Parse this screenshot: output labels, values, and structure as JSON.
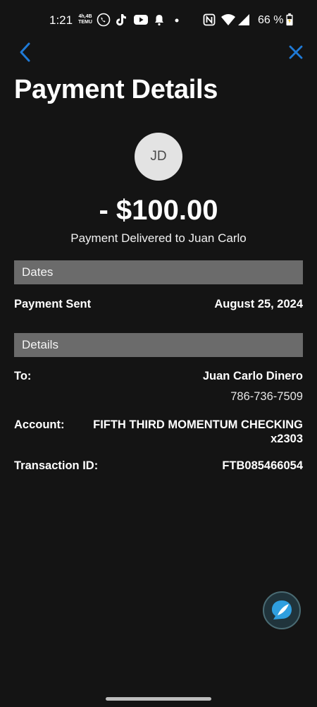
{
  "status_bar": {
    "time": "1:21",
    "temu_badge": "4h,4B TEMU",
    "battery_percent": "66 %",
    "icons": [
      "phone-icon",
      "tiktok-icon",
      "youtube-icon",
      "bell-icon",
      "dot-icon",
      "nfc-icon",
      "wifi-icon",
      "signal-icon",
      "battery-icon"
    ]
  },
  "header": {
    "title": "Payment Details",
    "back_icon": "chevron-left-icon",
    "close_icon": "close-icon"
  },
  "payment": {
    "avatar_initials": "JD",
    "amount": "- $100.00",
    "subtitle": "Payment Delivered to Juan Carlo"
  },
  "dates": {
    "section_title": "Dates",
    "payment_sent_label": "Payment Sent",
    "payment_sent_value": "August 25, 2024"
  },
  "details": {
    "section_title": "Details",
    "to_label": "To:",
    "to_name": "Juan Carlo Dinero",
    "to_phone": "786-736-7509",
    "account_label": "Account:",
    "account_line1": "FIFTH THIRD MOMENTUM CHECKING",
    "account_line2": "x2303",
    "transaction_label": "Transaction ID:",
    "transaction_value": "FTB085466054"
  },
  "colors": {
    "background": "#141414",
    "accent": "#1f7ad6",
    "section_header": "#6b6b6b"
  },
  "chat_fab_icon": "chat-bubble-icon"
}
